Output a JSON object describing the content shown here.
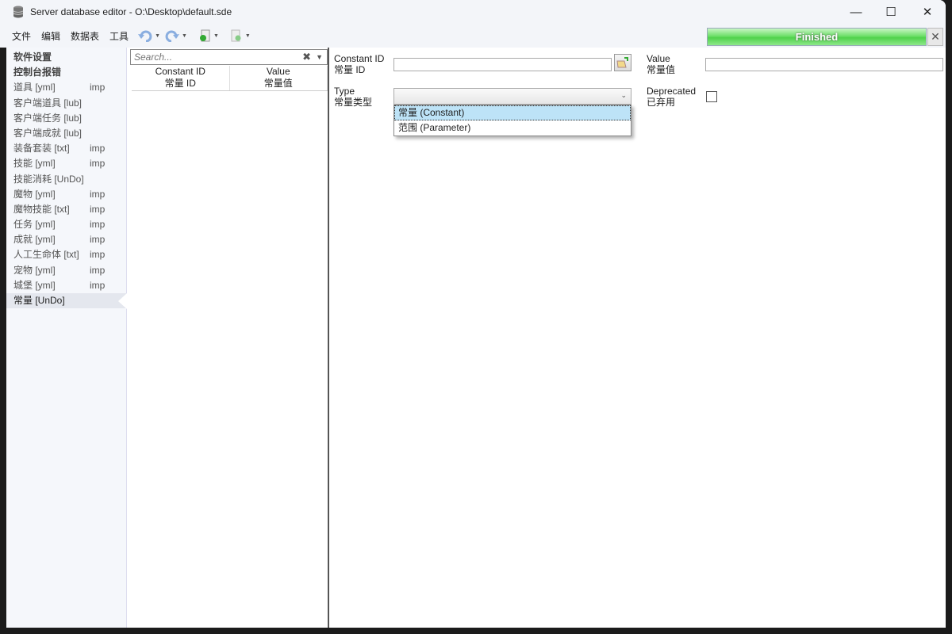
{
  "window": {
    "title": "Server database editor - O:\\Desktop\\default.sde",
    "minimize": "—",
    "maximize": "☐",
    "close": "✕"
  },
  "menu": [
    "文件",
    "编辑",
    "数据表",
    "工具"
  ],
  "toolbar": {
    "undo": "undo-icon",
    "redo": "redo-icon",
    "import": "import-icon",
    "export": "export-icon"
  },
  "progress": {
    "label": "Finished",
    "value": 100,
    "close": "✕"
  },
  "sidebar": {
    "items": [
      {
        "label": "软件设置",
        "bold": true,
        "tag": ""
      },
      {
        "label": "控制台报错",
        "bold": true,
        "tag": ""
      },
      {
        "label": "道具 [yml]",
        "tag": "imp"
      },
      {
        "label": "客户端道具 [lub]",
        "tag": ""
      },
      {
        "label": "客户端任务 [lub]",
        "tag": ""
      },
      {
        "label": "客户端成就 [lub]",
        "tag": ""
      },
      {
        "label": "装备套装 [txt]",
        "tag": "imp"
      },
      {
        "label": "技能 [yml]",
        "tag": "imp"
      },
      {
        "label": "技能消耗 [UnDo]",
        "tag": ""
      },
      {
        "label": "魔物 [yml]",
        "tag": "imp"
      },
      {
        "label": "魔物技能 [txt]",
        "tag": "imp"
      },
      {
        "label": "任务 [yml]",
        "tag": "imp"
      },
      {
        "label": "成就 [yml]",
        "tag": "imp"
      },
      {
        "label": "人工生命体 [txt]",
        "tag": "imp"
      },
      {
        "label": "宠物 [yml]",
        "tag": "imp"
      },
      {
        "label": "城堡 [yml]",
        "tag": "imp"
      },
      {
        "label": "常量 [UnDo]",
        "tag": "",
        "selected": true
      }
    ]
  },
  "list": {
    "search_placeholder": "Search...",
    "clear": "✖",
    "dropdown": "▾",
    "columns": [
      {
        "en": "Constant ID",
        "zh": "常量 ID"
      },
      {
        "en": "Value",
        "zh": "常量值"
      }
    ]
  },
  "form": {
    "constant_id": {
      "en": "Constant ID",
      "zh": "常量 ID",
      "value": ""
    },
    "value": {
      "en": "Value",
      "zh": "常量值",
      "value": ""
    },
    "type": {
      "en": "Type",
      "zh": "常量类型",
      "value": "",
      "options": [
        "常量 (Constant)",
        "范围 (Parameter)"
      ],
      "highlighted": 0
    },
    "deprecated": {
      "en": "Deprecated",
      "zh": "已弃用",
      "checked": false
    }
  }
}
